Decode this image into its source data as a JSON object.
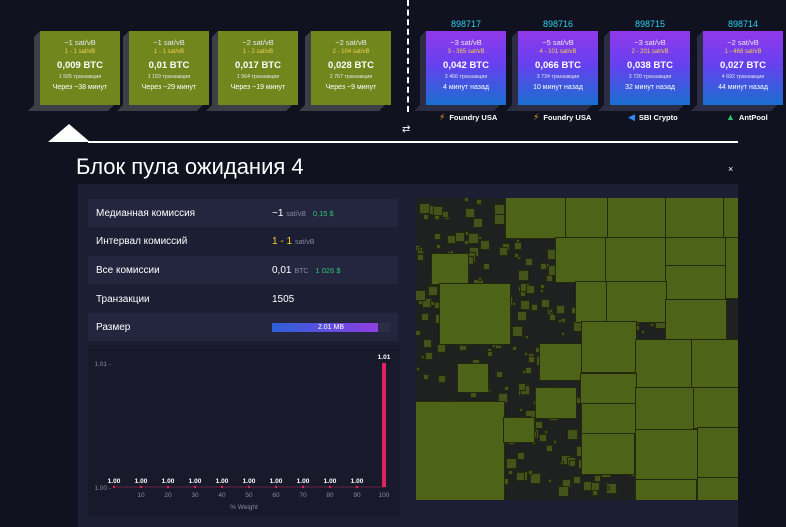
{
  "pending_blocks": [
    {
      "fee": "~1 sat/vB",
      "range": "1 - 1 sat/vB",
      "btc": "0,009 BTC",
      "txs": "1 505 транзакции",
      "eta": "Через ~38 минут"
    },
    {
      "fee": "~1 sat/vB",
      "range": "1 - 1 sat/vB",
      "btc": "0,01 BTC",
      "txs": "1 159 транзакции",
      "eta": "Через ~29 минут"
    },
    {
      "fee": "~2 sat/vB",
      "range": "1 - 2 sat/vB",
      "btc": "0,017 BTC",
      "txs": "1 564 транзакции",
      "eta": "Через ~19 минут"
    },
    {
      "fee": "~2 sat/vB",
      "range": "2 - 104 sat/vB",
      "btc": "0,028 BTC",
      "txs": "2 767 транзакции",
      "eta": "Через ~9 минут"
    }
  ],
  "mined_blocks": [
    {
      "height": "898717",
      "fee": "~3 sat/vB",
      "range": "3 - 365 sat/vB",
      "btc": "0,042 BTC",
      "txs": "3 466 транзакции",
      "time": "4 минут назад",
      "pool": "Foundry USA",
      "pool_icon": "foundry-icon"
    },
    {
      "height": "898716",
      "fee": "~5 sat/vB",
      "range": "4 - 101 sat/vB",
      "btc": "0,066 BTC",
      "txs": "3 734 транзакции",
      "time": "10 минут назад",
      "pool": "Foundry USA",
      "pool_icon": "foundry-icon"
    },
    {
      "height": "898715",
      "fee": "~3 sat/vB",
      "range": "2 - 201 sat/vB",
      "btc": "0,038 BTC",
      "txs": "3 720 транзакции",
      "time": "32 минут назад",
      "pool": "SBI Crypto",
      "pool_icon": "sbi-crypto-icon"
    },
    {
      "height": "898714",
      "fee": "~2 sat/vB",
      "range": "1 - 468 sat/vB",
      "btc": "0,027 BTC",
      "txs": "4 692 транзакции",
      "time": "44 минут назад",
      "pool": "AntPool",
      "pool_icon": "antpool-icon"
    }
  ],
  "swap_icon": "⇄",
  "panel": {
    "title": "Блок пула ожидания 4",
    "close": "×",
    "median_fee": {
      "label": "Медианная комиссия",
      "value": "~1",
      "unit": "sat/vB",
      "usd": "0,15 $"
    },
    "fee_span": {
      "label": "Интервал комиссий",
      "value": "1 - 1",
      "unit": "sat/vB"
    },
    "total_fees": {
      "label": "Все комиссии",
      "value": "0,01",
      "unit": "BTC",
      "usd": "1 026 $"
    },
    "transactions": {
      "label": "Транзакции",
      "value": "1505"
    },
    "size": {
      "label": "Размер",
      "value": "2.01 MB",
      "fill_fraction": 0.9
    }
  },
  "chart_data": {
    "type": "bar",
    "xlabel": "% Weight",
    "ylabel": "",
    "x": [
      0,
      10,
      20,
      30,
      40,
      50,
      60,
      70,
      80,
      90,
      100
    ],
    "tick_labels": [
      "10",
      "20",
      "30",
      "40",
      "50",
      "60",
      "70",
      "80",
      "90",
      "100"
    ],
    "y_ticks": [
      "1.01",
      "1.00"
    ],
    "ylim": [
      1.0,
      1.01
    ],
    "series": [
      {
        "values": [
          1.0,
          1.0,
          1.0,
          1.0,
          1.0,
          1.0,
          1.0,
          1.0,
          1.0,
          1.0,
          1.01
        ],
        "labels": [
          "1.00",
          "1.00",
          "1.00",
          "1.00",
          "1.00",
          "1.00",
          "1.00",
          "1.00",
          "1.00",
          "1.00",
          "1.01"
        ],
        "color": "#e0245e"
      }
    ]
  },
  "colors": {
    "pending": "#71871e",
    "mined_top": "#9139ea",
    "mined_bottom": "#1a6fcf",
    "height": "#2ed0f0",
    "usd": "#2ec36a",
    "treemap": "#4d6418"
  }
}
